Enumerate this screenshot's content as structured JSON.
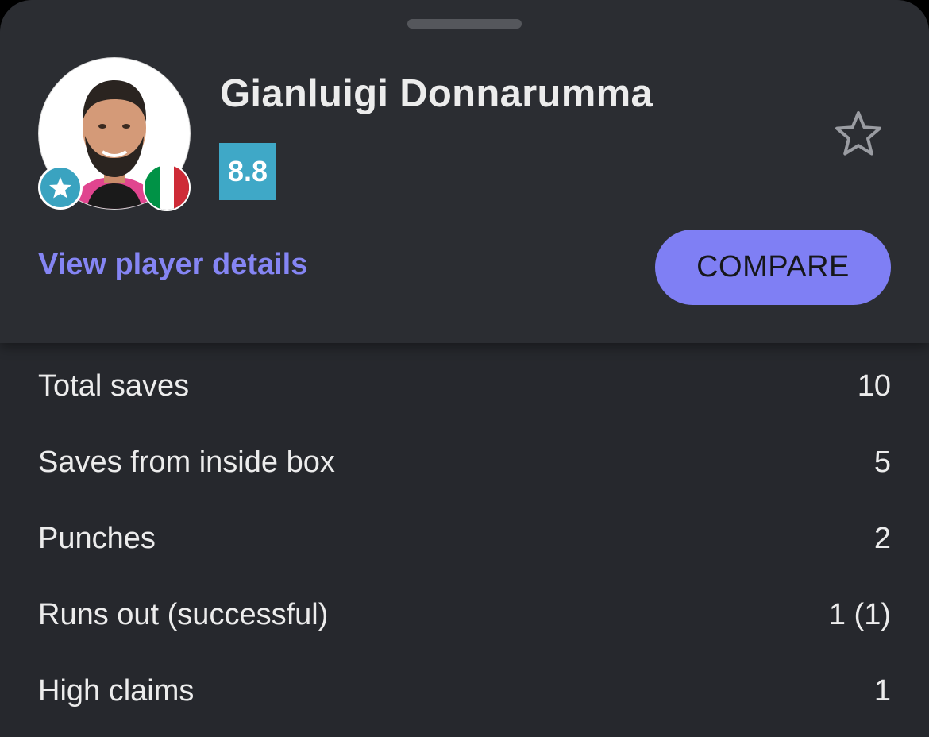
{
  "player": {
    "name": "Gianluigi Donnarumma",
    "rating": "8.8",
    "rating_color": "#3fa8c7",
    "avatar_icon": "player-photo",
    "position_badge_icon": "star-badge-icon",
    "nationality_flag": "italy-flag-icon",
    "flag_colors": [
      "#009246",
      "#ffffff",
      "#ce2b37"
    ],
    "favorite_icon": "star-outline-icon"
  },
  "actions": {
    "view_details_label": "View player details",
    "compare_label": "COMPARE",
    "accent_color": "#7f7ff4"
  },
  "stats": [
    {
      "label": "Total saves",
      "value": "10"
    },
    {
      "label": "Saves from inside box",
      "value": "5"
    },
    {
      "label": "Punches",
      "value": "2"
    },
    {
      "label": "Runs out (successful)",
      "value": "1 (1)"
    },
    {
      "label": "High claims",
      "value": "1"
    }
  ]
}
